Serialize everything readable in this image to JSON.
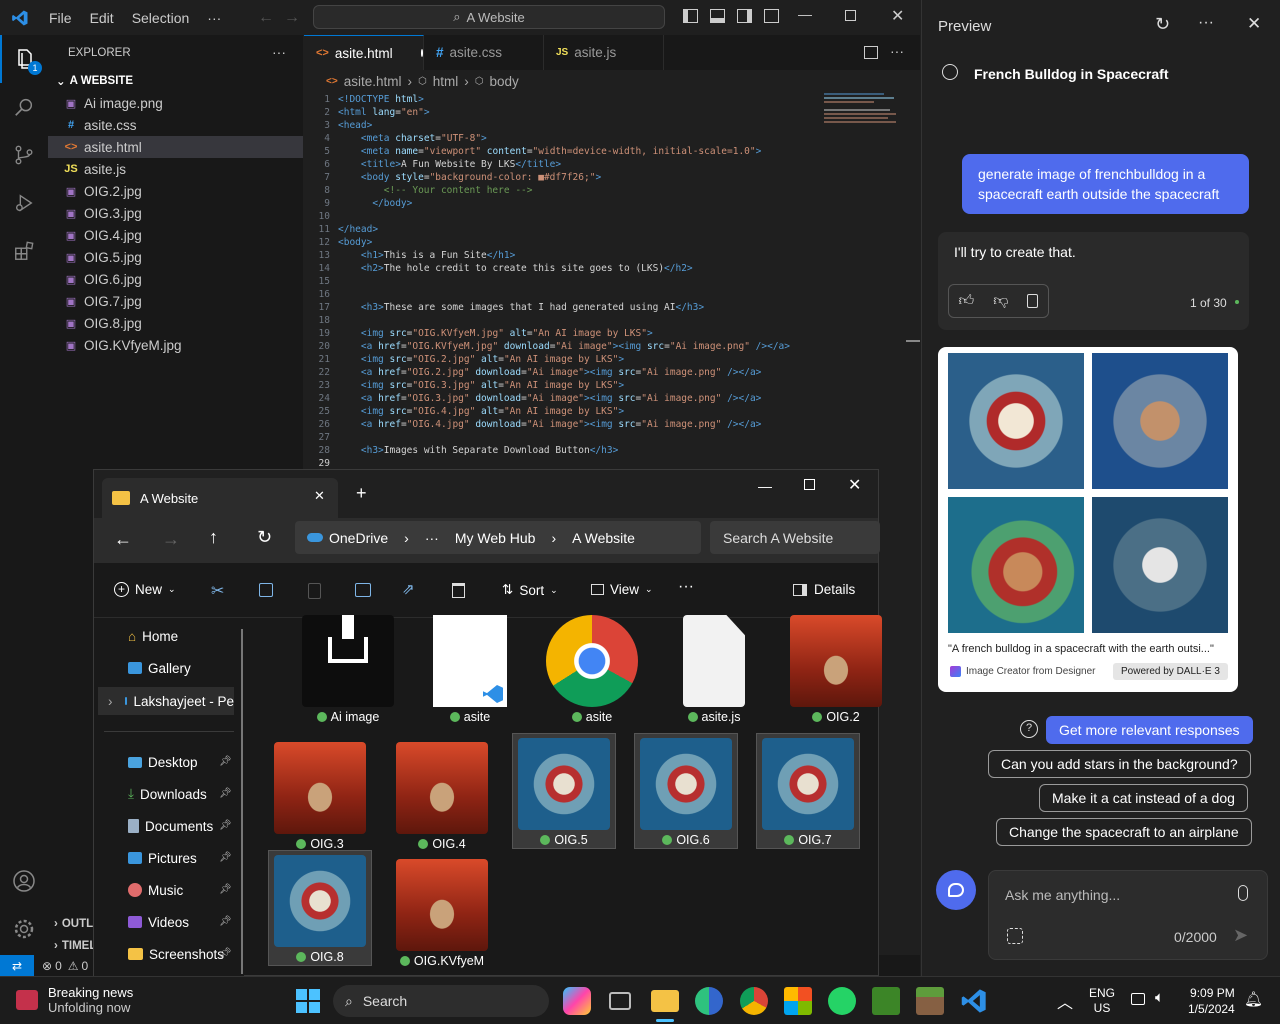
{
  "vscode": {
    "menu": [
      "File",
      "Edit",
      "Selection",
      "···"
    ],
    "command_center": "A Website",
    "sidebar": {
      "header": "EXPLORER",
      "folder": "A WEBSITE",
      "files": [
        {
          "name": "Ai image.png",
          "type": "img"
        },
        {
          "name": "asite.css",
          "type": "css"
        },
        {
          "name": "asite.html",
          "type": "html",
          "selected": true
        },
        {
          "name": "asite.js",
          "type": "js"
        },
        {
          "name": "OIG.2.jpg",
          "type": "img"
        },
        {
          "name": "OIG.3.jpg",
          "type": "img"
        },
        {
          "name": "OIG.4.jpg",
          "type": "img"
        },
        {
          "name": "OIG.5.jpg",
          "type": "img"
        },
        {
          "name": "OIG.6.jpg",
          "type": "img"
        },
        {
          "name": "OIG.7.jpg",
          "type": "img"
        },
        {
          "name": "OIG.8.jpg",
          "type": "img"
        },
        {
          "name": "OIG.KVfyeM.jpg",
          "type": "img"
        }
      ],
      "outline": "OUTLINE",
      "timeline": "TIMELINE"
    },
    "tabs": [
      {
        "label": "asite.html",
        "active": true
      },
      {
        "label": "asite.css"
      },
      {
        "label": "asite.js"
      }
    ],
    "breadcrumb": [
      "asite.html",
      "html",
      "body"
    ],
    "code": [
      [
        [
          "tg",
          "<!DOCTYPE "
        ],
        [
          "at",
          "html"
        ],
        [
          "tg",
          ">"
        ]
      ],
      [
        [
          "tg",
          "<html "
        ],
        [
          "at",
          "lang"
        ],
        [
          "tx",
          "="
        ],
        [
          "sv",
          "\"en\""
        ],
        [
          "tg",
          ">"
        ]
      ],
      [
        [
          "tg",
          "<head>"
        ]
      ],
      [
        [
          "tx",
          "    "
        ],
        [
          "tg",
          "<meta "
        ],
        [
          "at",
          "charset"
        ],
        [
          "tx",
          "="
        ],
        [
          "sv",
          "\"UTF-8\""
        ],
        [
          "tg",
          ">"
        ]
      ],
      [
        [
          "tx",
          "    "
        ],
        [
          "tg",
          "<meta "
        ],
        [
          "at",
          "name"
        ],
        [
          "tx",
          "="
        ],
        [
          "sv",
          "\"viewport\" "
        ],
        [
          "at",
          "content"
        ],
        [
          "tx",
          "="
        ],
        [
          "sv",
          "\"width=device-width, initial-scale=1.0\""
        ],
        [
          "tg",
          ">"
        ]
      ],
      [
        [
          "tx",
          "    "
        ],
        [
          "tg",
          "<title>"
        ],
        [
          "tx",
          "A Fun Website By LKS"
        ],
        [
          "tg",
          "</title>"
        ]
      ],
      [
        [
          "tx",
          "    "
        ],
        [
          "tg",
          "<body "
        ],
        [
          "at",
          "style"
        ],
        [
          "tx",
          "="
        ],
        [
          "sv",
          "\"background-color: ■#df7f26;\""
        ],
        [
          "tg",
          ">"
        ]
      ],
      [
        [
          "tx",
          "        "
        ],
        [
          "cm",
          "<!-- Your content here -->"
        ]
      ],
      [
        [
          "tx",
          "      "
        ],
        [
          "tg",
          "</body>"
        ]
      ],
      [],
      [
        [
          "tg",
          "</head>"
        ]
      ],
      [
        [
          "tg",
          "<body>"
        ]
      ],
      [
        [
          "tx",
          "    "
        ],
        [
          "tg",
          "<h1>"
        ],
        [
          "tx",
          "This is a Fun Site"
        ],
        [
          "tg",
          "</h1>"
        ]
      ],
      [
        [
          "tx",
          "    "
        ],
        [
          "tg",
          "<h2>"
        ],
        [
          "tx",
          "The hole credit to create this site goes to (LKS)"
        ],
        [
          "tg",
          "</h2>"
        ]
      ],
      [],
      [],
      [
        [
          "tx",
          "    "
        ],
        [
          "tg",
          "<h3>"
        ],
        [
          "tx",
          "These are some images that I had generated using AI"
        ],
        [
          "tg",
          "</h3>"
        ]
      ],
      [],
      [
        [
          "tx",
          "    "
        ],
        [
          "tg",
          "<img "
        ],
        [
          "at",
          "src"
        ],
        [
          "tx",
          "="
        ],
        [
          "sv",
          "\"OIG.KVfyeM.jpg\" "
        ],
        [
          "at",
          "alt"
        ],
        [
          "tx",
          "="
        ],
        [
          "sv",
          "\"An AI image by LKS\""
        ],
        [
          "tg",
          ">"
        ]
      ],
      [
        [
          "tx",
          "    "
        ],
        [
          "tg",
          "<a "
        ],
        [
          "at",
          "href"
        ],
        [
          "tx",
          "="
        ],
        [
          "sv",
          "\"OIG.KVfyeM.jpg\" "
        ],
        [
          "at",
          "download"
        ],
        [
          "tx",
          "="
        ],
        [
          "sv",
          "\"Ai image\""
        ],
        [
          "tg",
          "><img "
        ],
        [
          "at",
          "src"
        ],
        [
          "tx",
          "="
        ],
        [
          "sv",
          "\"Ai image.png\" "
        ],
        [
          "tg",
          "/></a>"
        ]
      ],
      [
        [
          "tx",
          "    "
        ],
        [
          "tg",
          "<img "
        ],
        [
          "at",
          "src"
        ],
        [
          "tx",
          "="
        ],
        [
          "sv",
          "\"OIG.2.jpg\" "
        ],
        [
          "at",
          "alt"
        ],
        [
          "tx",
          "="
        ],
        [
          "sv",
          "\"An AI image by LKS\""
        ],
        [
          "tg",
          ">"
        ]
      ],
      [
        [
          "tx",
          "    "
        ],
        [
          "tg",
          "<a "
        ],
        [
          "at",
          "href"
        ],
        [
          "tx",
          "="
        ],
        [
          "sv",
          "\"OIG.2.jpg\" "
        ],
        [
          "at",
          "download"
        ],
        [
          "tx",
          "="
        ],
        [
          "sv",
          "\"Ai image\""
        ],
        [
          "tg",
          "><img "
        ],
        [
          "at",
          "src"
        ],
        [
          "tx",
          "="
        ],
        [
          "sv",
          "\"Ai image.png\" "
        ],
        [
          "tg",
          "/></a>"
        ]
      ],
      [
        [
          "tx",
          "    "
        ],
        [
          "tg",
          "<img "
        ],
        [
          "at",
          "src"
        ],
        [
          "tx",
          "="
        ],
        [
          "sv",
          "\"OIG.3.jpg\" "
        ],
        [
          "at",
          "alt"
        ],
        [
          "tx",
          "="
        ],
        [
          "sv",
          "\"An AI image by LKS\""
        ],
        [
          "tg",
          ">"
        ]
      ],
      [
        [
          "tx",
          "    "
        ],
        [
          "tg",
          "<a "
        ],
        [
          "at",
          "href"
        ],
        [
          "tx",
          "="
        ],
        [
          "sv",
          "\"OIG.3.jpg\" "
        ],
        [
          "at",
          "download"
        ],
        [
          "tx",
          "="
        ],
        [
          "sv",
          "\"Ai image\""
        ],
        [
          "tg",
          "><img "
        ],
        [
          "at",
          "src"
        ],
        [
          "tx",
          "="
        ],
        [
          "sv",
          "\"Ai image.png\" "
        ],
        [
          "tg",
          "/></a>"
        ]
      ],
      [
        [
          "tx",
          "    "
        ],
        [
          "tg",
          "<img "
        ],
        [
          "at",
          "src"
        ],
        [
          "tx",
          "="
        ],
        [
          "sv",
          "\"OIG.4.jpg\" "
        ],
        [
          "at",
          "alt"
        ],
        [
          "tx",
          "="
        ],
        [
          "sv",
          "\"An AI image by LKS\""
        ],
        [
          "tg",
          ">"
        ]
      ],
      [
        [
          "tx",
          "    "
        ],
        [
          "tg",
          "<a "
        ],
        [
          "at",
          "href"
        ],
        [
          "tx",
          "="
        ],
        [
          "sv",
          "\"OIG.4.jpg\" "
        ],
        [
          "at",
          "download"
        ],
        [
          "tx",
          "="
        ],
        [
          "sv",
          "\"Ai image\""
        ],
        [
          "tg",
          "><img "
        ],
        [
          "at",
          "src"
        ],
        [
          "tx",
          "="
        ],
        [
          "sv",
          "\"Ai image.png\" "
        ],
        [
          "tg",
          "/></a>"
        ]
      ],
      [],
      [
        [
          "tx",
          "    "
        ],
        [
          "tg",
          "<h3>"
        ],
        [
          "tx",
          "Images with Separate Download Button"
        ],
        [
          "tg",
          "</h3>"
        ]
      ],
      []
    ],
    "status": {
      "errors": "0",
      "warnings": "0"
    }
  },
  "copilot": {
    "title": "Preview",
    "conversation_title": "French Bulldog in Spacecraft",
    "user_message": "generate image of frenchbulldog in a spacecraft  earth outside the spacecraft",
    "bot_message": "I'll try to create that.",
    "counter": "1 of 30",
    "image_caption": "\"A french bulldog in a spacecraft with the earth outsi...\"",
    "image_source": "Image Creator from Designer",
    "powered_by": "Powered by DALL·E 3",
    "suggestions": [
      "Get more relevant responses",
      "Can you add stars in the background?",
      "Make it a cat instead of a dog",
      "Change the spacecraft to an airplane"
    ],
    "input_placeholder": "Ask me anything...",
    "char_count": "0/2000",
    "colors": {
      "accent": "#4f6bed",
      "panel": "#202020"
    }
  },
  "file_explorer": {
    "tab_title": "A Website",
    "breadcrumb": [
      "OneDrive",
      "···",
      "My Web Hub",
      "A Website"
    ],
    "search_placeholder": "Search A Website",
    "commands": {
      "new": "New",
      "sort": "Sort",
      "view": "View",
      "details": "Details"
    },
    "nav": {
      "home": "Home",
      "gallery": "Gallery",
      "onedrive": "Lakshayjeet - Pe",
      "quick": [
        "Desktop",
        "Downloads",
        "Documents",
        "Pictures",
        "Music",
        "Videos",
        "Screenshots"
      ]
    },
    "files": [
      {
        "name": "Ai image",
        "kind": "download"
      },
      {
        "name": "asite",
        "kind": "html"
      },
      {
        "name": "asite",
        "kind": "chrome"
      },
      {
        "name": "asite.js",
        "kind": "doc"
      },
      {
        "name": "OIG.2",
        "kind": "mars"
      },
      {
        "name": "OIG.3",
        "kind": "mars"
      },
      {
        "name": "OIG.4",
        "kind": "mars"
      },
      {
        "name": "OIG.5",
        "kind": "space",
        "selected": true
      },
      {
        "name": "OIG.6",
        "kind": "space",
        "selected": true
      },
      {
        "name": "OIG.7",
        "kind": "space",
        "selected": true
      },
      {
        "name": "OIG.8",
        "kind": "space",
        "selected": true
      },
      {
        "name": "OIG.KVfyeM",
        "kind": "mars"
      }
    ]
  },
  "taskbar": {
    "news_title": "Breaking news",
    "news_sub": "Unfolding now",
    "search": "Search",
    "lang1": "ENG",
    "lang2": "US",
    "time": "9:09 PM",
    "date": "1/5/2024"
  }
}
